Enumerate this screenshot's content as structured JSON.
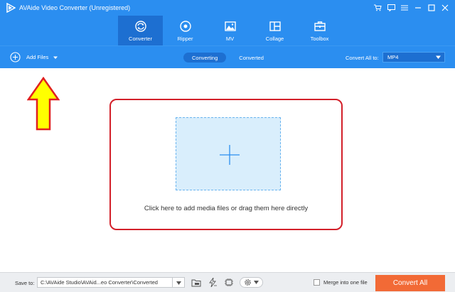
{
  "window": {
    "title": "AVAide Video Converter (Unregistered)",
    "controls": [
      {
        "name": "cart-icon",
        "glyph": "🛒"
      },
      {
        "name": "feedback-icon",
        "glyph": "▭"
      },
      {
        "name": "menu-icon",
        "glyph": "≡"
      },
      {
        "name": "minimize-icon",
        "glyph": "–"
      },
      {
        "name": "maximize-icon",
        "glyph": "□"
      },
      {
        "name": "close-icon",
        "glyph": "✕"
      }
    ]
  },
  "nav": {
    "tabs": [
      {
        "label": "Converter",
        "icon": "converter-icon",
        "active": true
      },
      {
        "label": "Ripper",
        "icon": "disc-icon",
        "active": false
      },
      {
        "label": "MV",
        "icon": "image-icon",
        "active": false
      },
      {
        "label": "Collage",
        "icon": "collage-icon",
        "active": false
      },
      {
        "label": "Toolbox",
        "icon": "toolbox-icon",
        "active": false
      }
    ]
  },
  "toolbar": {
    "add_files": "Add Files",
    "segments": [
      "Converting",
      "Converted"
    ],
    "convert_all_label": "Convert All to:",
    "format": "MP4"
  },
  "main": {
    "drop_hint": "Click here to add media files or drag them here directly"
  },
  "footer": {
    "save_to_label": "Save to:",
    "save_path": "C:\\AVAide Studio\\AVAid...eo Converter\\Converted",
    "merge_label": "Merge into one file",
    "convert_all_button": "Convert All"
  },
  "colors": {
    "header_blue": "#2b8ef0",
    "active_tab": "#1d6fd1",
    "highlight_red": "#d3202a",
    "arrow_yellow": "#ffff00",
    "convert_orange": "#f26a36"
  }
}
